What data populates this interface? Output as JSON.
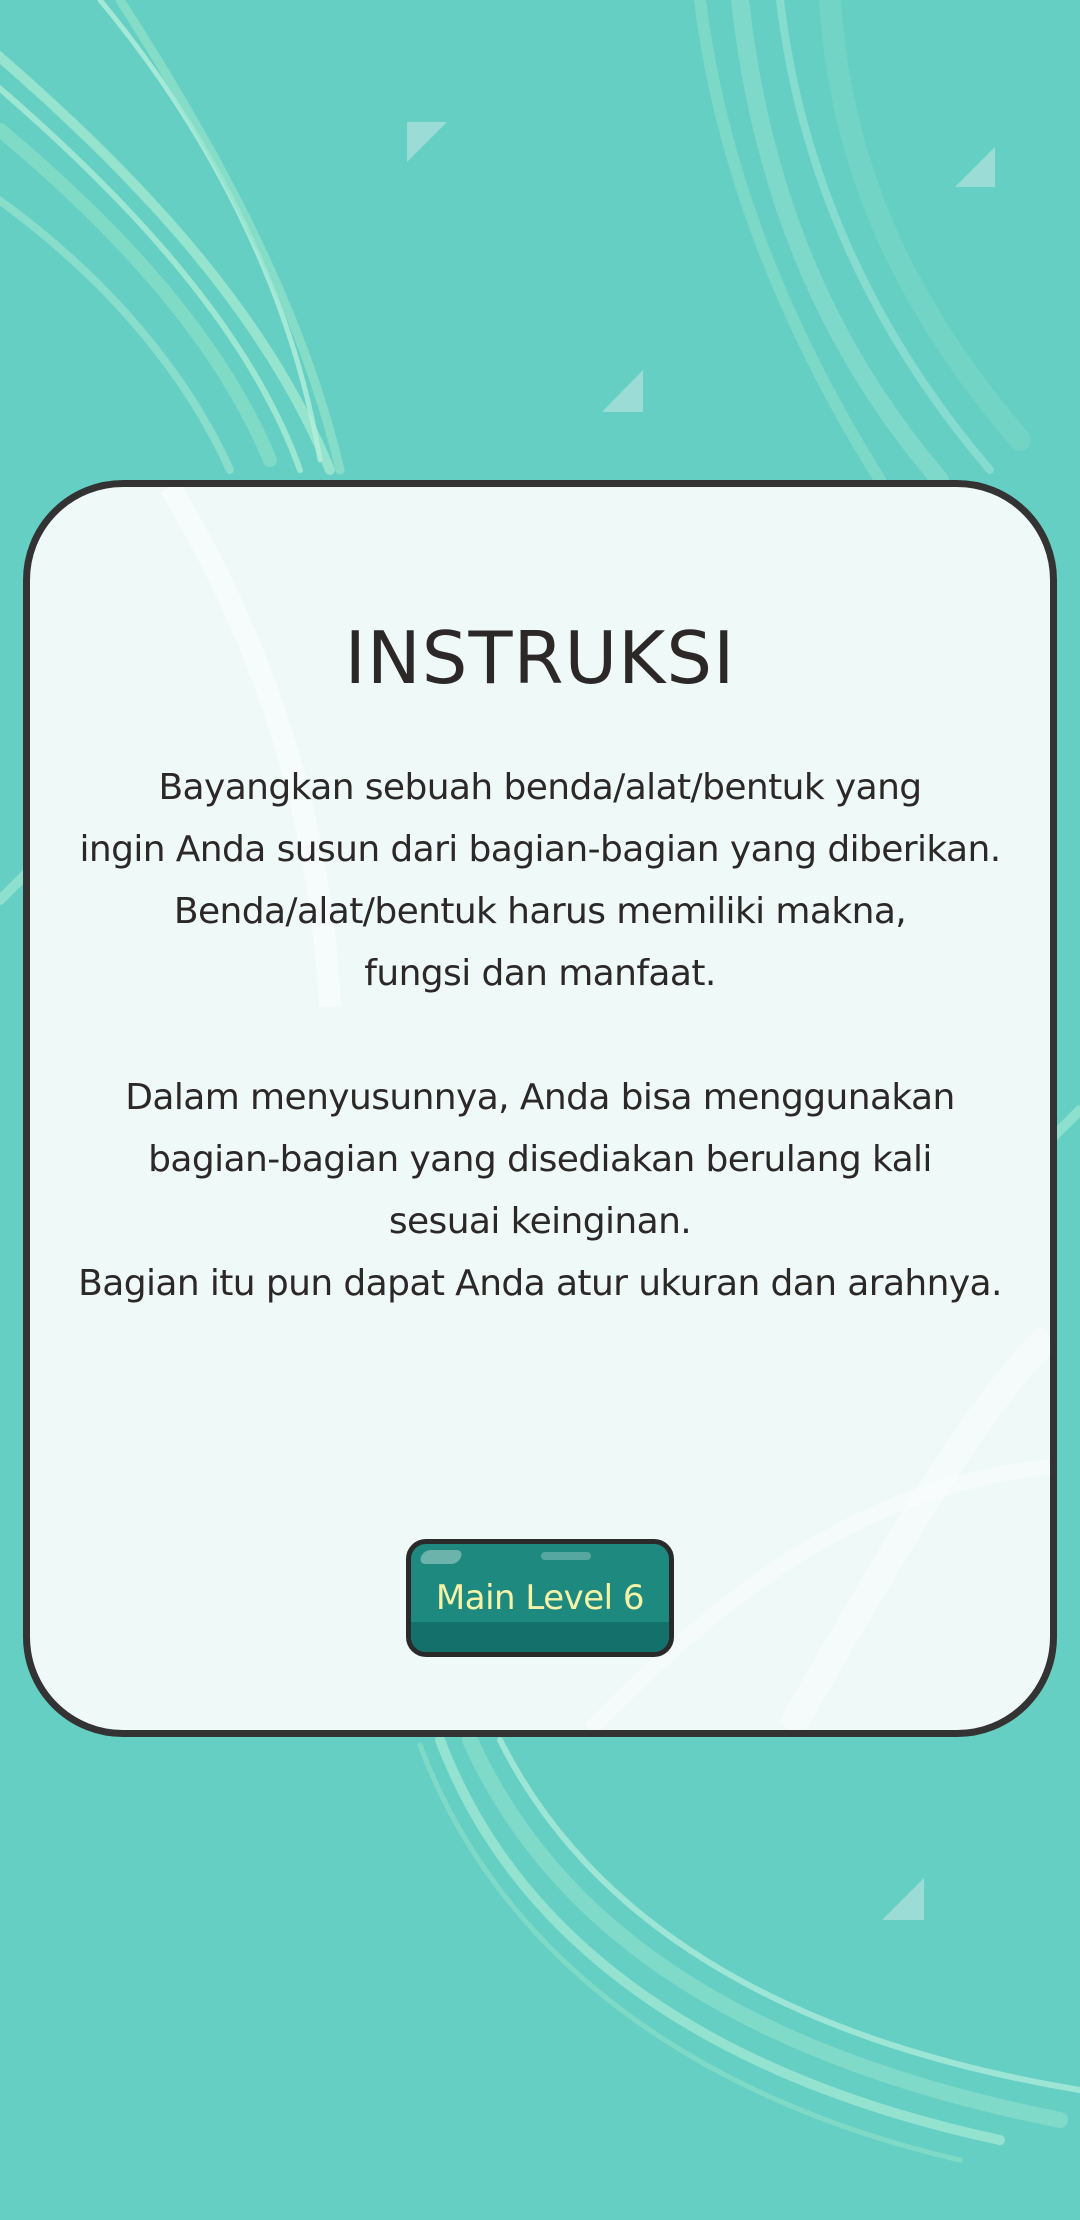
{
  "colors": {
    "background": "#66cfc4",
    "card_background": "#eff9f8",
    "card_border": "#333333",
    "text": "#2c2828",
    "button_background": "#1e8a7f",
    "button_text": "#f6f3a9"
  },
  "instructions": {
    "title": "INSTRUKSI",
    "lines": [
      "Bayangkan sebuah benda/alat/bentuk yang",
      "ingin Anda susun dari bagian-bagian yang diberikan.",
      "Benda/alat/bentuk harus memiliki makna,",
      "fungsi dan manfaat.",
      "",
      "Dalam menyusunnya, Anda bisa menggunakan",
      "bagian-bagian yang disediakan berulang kali",
      "sesuai keinginan.",
      "Bagian itu pun dapat Anda atur ukuran dan arahnya."
    ]
  },
  "play_button": {
    "label": "Main Level 6"
  }
}
